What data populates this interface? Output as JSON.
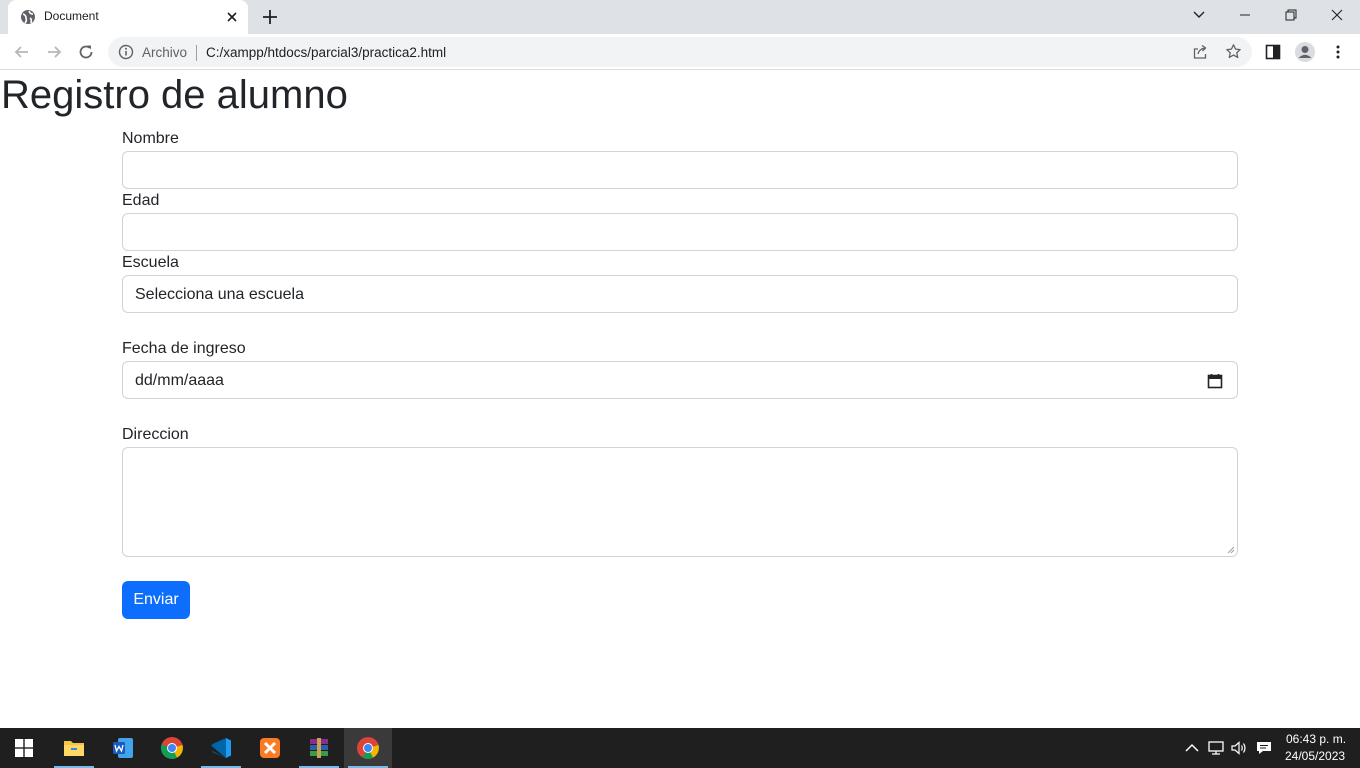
{
  "browser": {
    "tab_title": "Document",
    "omnibox_scheme_label": "Archivo",
    "url": "C:/xampp/htdocs/parcial3/practica2.html"
  },
  "page": {
    "title": "Registro de alumno",
    "form": {
      "nombre_label": "Nombre",
      "nombre_value": "",
      "edad_label": "Edad",
      "edad_value": "",
      "escuela_label": "Escuela",
      "escuela_selected": "Selecciona una escuela",
      "fecha_label": "Fecha de ingreso",
      "fecha_placeholder": "dd/mm/aaaa",
      "direccion_label": "Direccion",
      "direccion_value": "",
      "submit_label": "Enviar"
    }
  },
  "taskbar": {
    "apps": [
      "windows-start",
      "file-explorer",
      "word",
      "chrome",
      "vscode",
      "xampp",
      "winrar",
      "chrome-active"
    ],
    "time": "06:43 p. m.",
    "date": "24/05/2023"
  },
  "colors": {
    "primary_button": "#0d6efd",
    "tabstrip": "#dee1e6",
    "taskbar": "#1f1f1f"
  }
}
